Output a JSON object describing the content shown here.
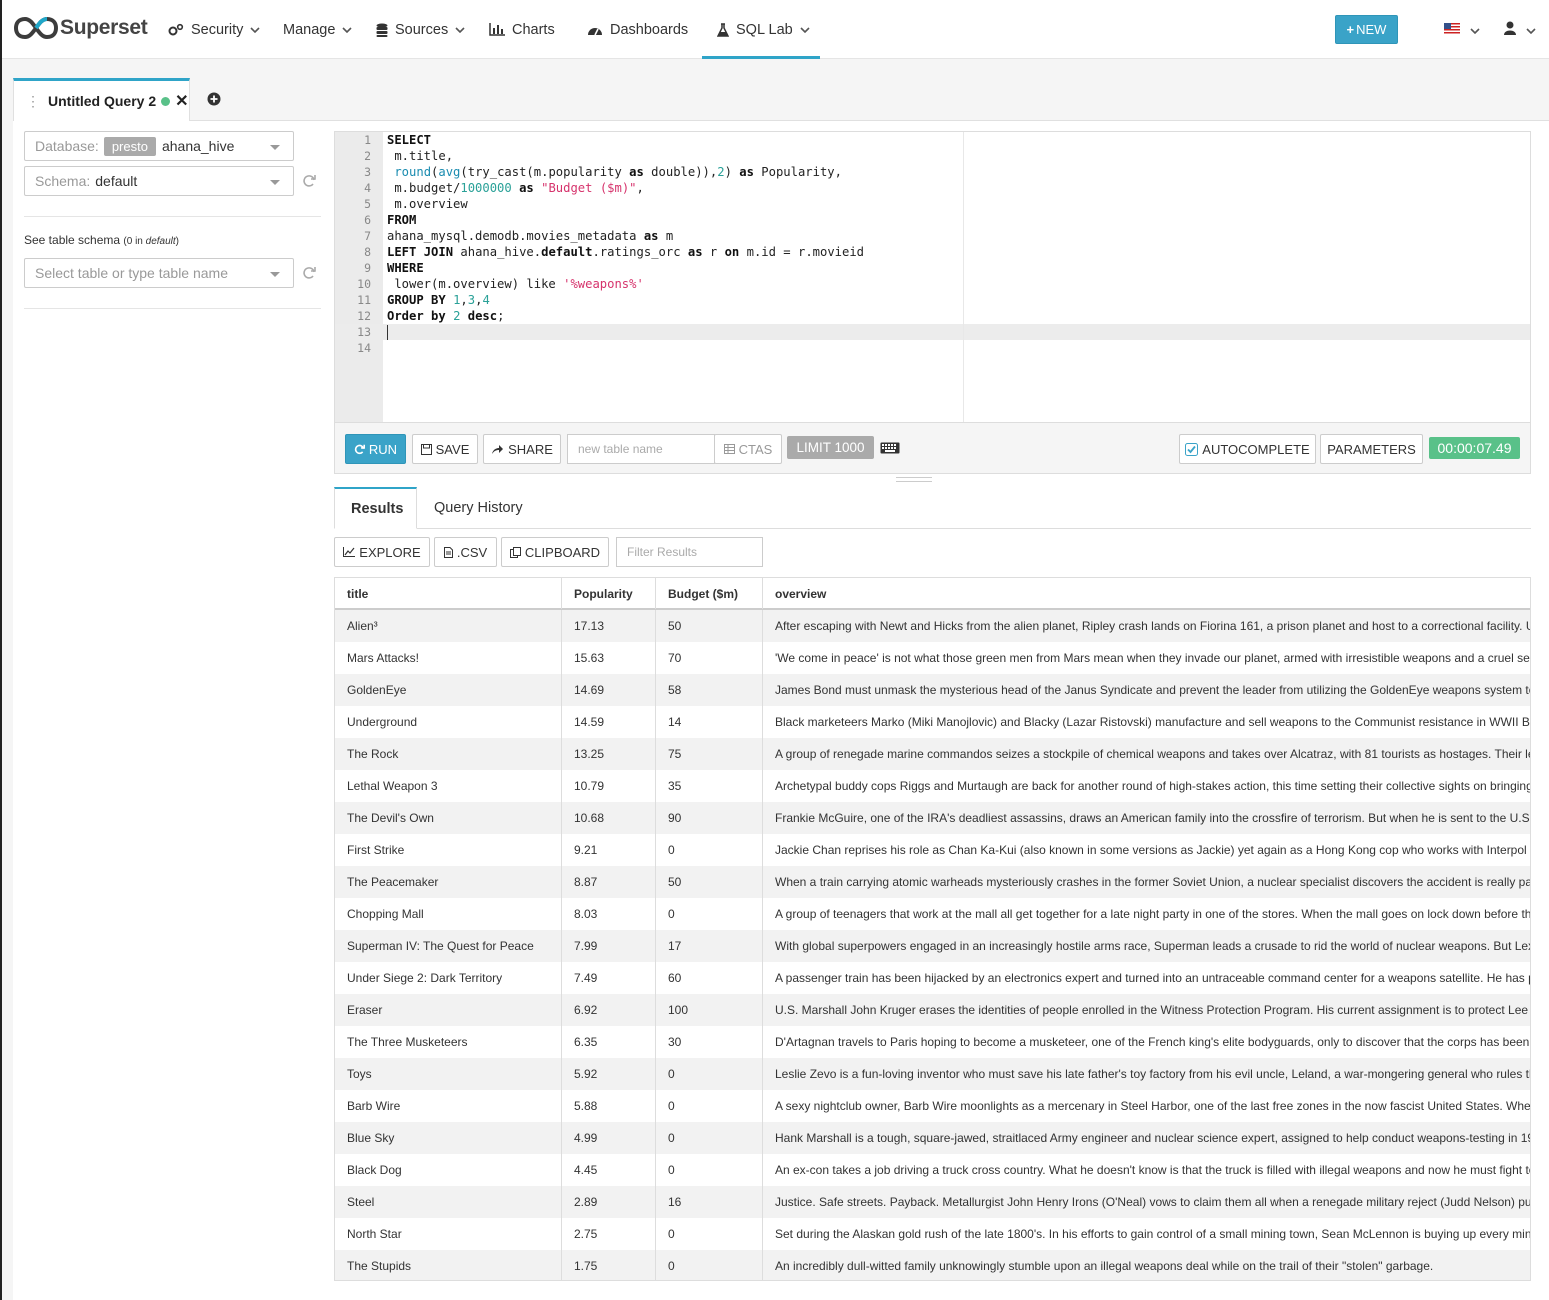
{
  "nav": {
    "brand": "Superset",
    "items": [
      {
        "label": "Security",
        "icon": "gears-icon",
        "caret": true
      },
      {
        "label": "Manage",
        "icon": "",
        "caret": true
      },
      {
        "label": "Sources",
        "icon": "database-icon",
        "caret": true
      },
      {
        "label": "Charts",
        "icon": "bar-chart-icon",
        "caret": false
      },
      {
        "label": "Dashboards",
        "icon": "dashboard-icon",
        "caret": false
      },
      {
        "label": "SQL Lab",
        "icon": "flask-icon",
        "caret": true,
        "active": true
      }
    ],
    "new_button": "NEW",
    "accent_color": "#2fa4c8"
  },
  "query_tab": {
    "title": "Untitled Query 2"
  },
  "sidebar": {
    "database_label": "Database:",
    "database_engine": "presto",
    "database_value": "ahana_hive",
    "schema_label": "Schema:",
    "schema_value": "default",
    "see_schema": "See table schema",
    "see_schema_count_pre": "(0 in ",
    "see_schema_count_schema": "default",
    "see_schema_count_post": ")",
    "table_placeholder": "Select table or type table name"
  },
  "editor": {
    "line_numbers": [
      "1",
      "2",
      "3",
      "4",
      "5",
      "6",
      "7",
      "8",
      "9",
      "10",
      "11",
      "12",
      "13",
      "14"
    ],
    "lines": [
      "SELECT",
      " m.title,",
      " round(avg(try_cast(m.popularity as double)),2) as Popularity,",
      " m.budget/1000000 as \"Budget ($m)\",",
      " m.overview",
      "FROM",
      "ahana_mysql.demodb.movies_metadata as m",
      "LEFT JOIN ahana_hive.default.ratings_orc as r on m.id = r.movieid",
      "WHERE",
      " lower(m.overview) like '%weapons%'",
      "GROUP BY 1,3,4",
      "Order by 2 desc;",
      "",
      ""
    ]
  },
  "toolbar": {
    "run": "RUN",
    "save": "SAVE",
    "share": "SHARE",
    "new_table_placeholder": "new table name",
    "ctas": "CTAS",
    "limit": "LIMIT 1000",
    "autocomplete": "AUTOCOMPLETE",
    "parameters": "PARAMETERS",
    "timer": "00:00:07.49"
  },
  "results": {
    "tabs": [
      "Results",
      "Query History"
    ],
    "explore": "EXPLORE",
    "csv": ".CSV",
    "clipboard": "CLIPBOARD",
    "filter_placeholder": "Filter Results",
    "columns": [
      "title",
      "Popularity",
      "Budget ($m)",
      "overview"
    ],
    "rows": [
      [
        "Alien³",
        "17.13",
        "50",
        "After escaping with Newt and Hicks from the alien planet, Ripley crash lands on Fiorina 161, a prison planet and host to a correctional facility. U"
      ],
      [
        "Mars Attacks!",
        "15.63",
        "70",
        "'We come in peace' is not what those green men from Mars mean when they invade our planet, armed with irresistible weapons and a cruel sen"
      ],
      [
        "GoldenEye",
        "14.69",
        "58",
        "James Bond must unmask the mysterious head of the Janus Syndicate and prevent the leader from utilizing the GoldenEye weapons system to"
      ],
      [
        "Underground",
        "14.59",
        "14",
        "Black marketeers Marko (Miki Manojlovic) and Blacky (Lazar Ristovski) manufacture and sell weapons to the Communist resistance in WWII Be"
      ],
      [
        "The Rock",
        "13.25",
        "75",
        "A group of renegade marine commandos seizes a stockpile of chemical weapons and takes over Alcatraz, with 81 tourists as hostages. Their le"
      ],
      [
        "Lethal Weapon 3",
        "10.79",
        "35",
        "Archetypal buddy cops Riggs and Murtaugh are back for another round of high-stakes action, this time setting their collective sights on bringing"
      ],
      [
        "The Devil's Own",
        "10.68",
        "90",
        "Frankie McGuire, one of the IRA's deadliest assassins, draws an American family into the crossfire of terrorism. But when he is sent to the U.S."
      ],
      [
        "First Strike",
        "9.21",
        "0",
        "Jackie Chan reprises his role as Chan Ka-Kui (also known in some versions as Jackie) yet again as a Hong Kong cop who works with Interpol t"
      ],
      [
        "The Peacemaker",
        "8.87",
        "50",
        "When a train carrying atomic warheads mysteriously crashes in the former Soviet Union, a nuclear specialist discovers the accident is really pa"
      ],
      [
        "Chopping Mall",
        "8.03",
        "0",
        "A group of teenagers that work at the mall all get together for a late night party in one of the stores. When the mall goes on lock down before th"
      ],
      [
        "Superman IV: The Quest for Peace",
        "7.99",
        "17",
        "With global superpowers engaged in an increasingly hostile arms race, Superman leads a crusade to rid the world of nuclear weapons. But Lex"
      ],
      [
        "Under Siege 2: Dark Territory",
        "7.49",
        "60",
        "A passenger train has been hijacked by an electronics expert and turned into an untraceable command center for a weapons satellite. He has p"
      ],
      [
        "Eraser",
        "6.92",
        "100",
        "U.S. Marshall John Kruger erases the identities of people enrolled in the Witness Protection Program. His current assignment is to protect Lee"
      ],
      [
        "The Three Musketeers",
        "6.35",
        "30",
        "D'Artagnan travels to Paris hoping to become a musketeer, one of the French king's elite bodyguards, only to discover that the corps has been"
      ],
      [
        "Toys",
        "5.92",
        "0",
        "Leslie Zevo is a fun-loving inventor who must save his late father's toy factory from his evil uncle, Leland, a war-mongering general who rules th"
      ],
      [
        "Barb Wire",
        "5.88",
        "0",
        "A sexy nightclub owner, Barb Wire moonlights as a mercenary in Steel Harbor, one of the last free zones in the now fascist United States. Whe"
      ],
      [
        "Blue Sky",
        "4.99",
        "0",
        "Hank Marshall is a tough, square-jawed, straitlaced Army engineer and nuclear science expert, assigned to help conduct weapons-testing in 19"
      ],
      [
        "Black Dog",
        "4.45",
        "0",
        "An ex-con takes a job driving a truck cross country. What he doesn't know is that the truck is filled with illegal weapons and now he must fight to"
      ],
      [
        "Steel",
        "2.89",
        "16",
        "Justice. Safe streets. Payback. Metallurgist John Henry Irons (O'Neal) vows to claim them all when a renegade military reject (Judd Nelson) pu"
      ],
      [
        "North Star",
        "2.75",
        "0",
        "Set during the Alaskan gold rush of the late 1800's. In his efforts to gain control of a small mining town, Sean McLennon is buying up every min"
      ],
      [
        "The Stupids",
        "1.75",
        "0",
        "An incredibly dull-witted family unknowingly stumble upon an illegal weapons deal while on the trail of their \"stolen\" garbage."
      ]
    ]
  }
}
